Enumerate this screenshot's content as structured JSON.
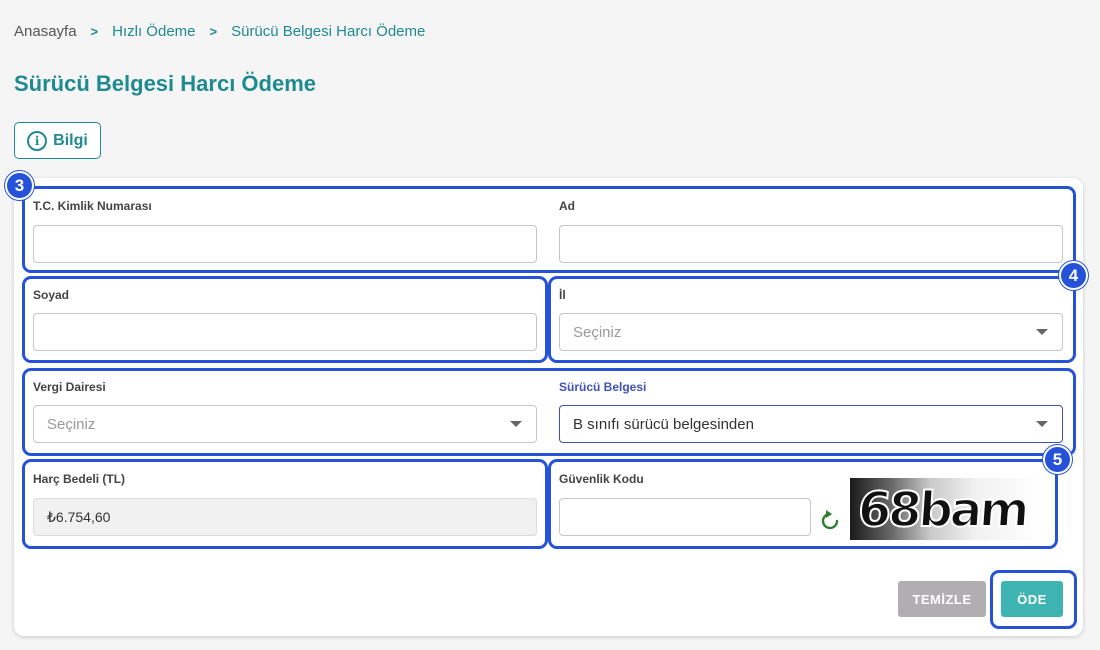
{
  "breadcrumb": {
    "home": "Anasayfa",
    "items": [
      "Hızlı Ödeme",
      "Sürücü Belgesi Harcı Ödeme"
    ]
  },
  "page_title": "Sürücü Belgesi Harcı Ödeme",
  "info_button": {
    "label": "Bilgi",
    "icon": "info-icon"
  },
  "form": {
    "tc_label": "T.C. Kimlik Numarası",
    "tc_value": "",
    "ad_label": "Ad",
    "ad_value": "",
    "soyad_label": "Soyad",
    "soyad_value": "",
    "il_label": "İl",
    "il_placeholder": "Seçiniz",
    "vergi_label": "Vergi Dairesi",
    "vergi_placeholder": "Seçiniz",
    "surucu_label": "Sürücü Belgesi",
    "surucu_value": "B sınıfı sürücü belgesinden",
    "harc_label": "Harç Bedeli (TL)",
    "harc_value": "₺6.754,60",
    "guvenlik_label": "Güvenlik Kodu",
    "guvenlik_value": "",
    "captcha_text": "68bam"
  },
  "markers": [
    "3",
    "4",
    "5"
  ],
  "buttons": {
    "clear": "TEMİZLE",
    "pay": "ÖDE"
  },
  "colors": {
    "accent": "#1f8a91",
    "highlight": "#2552d9",
    "pay": "#3fb5b3",
    "clear": "#b1aeb1",
    "focus": "#3f51b5"
  }
}
